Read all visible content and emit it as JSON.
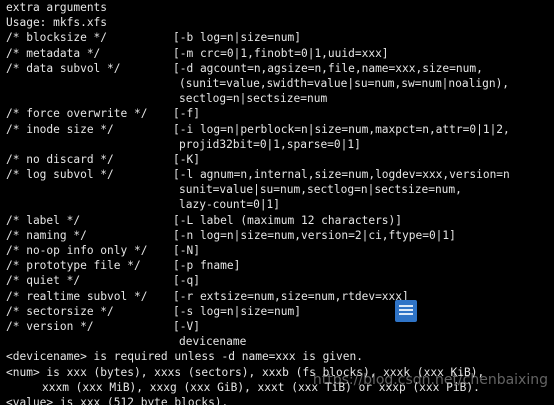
{
  "header": {
    "line1": "extra arguments",
    "line2": "Usage: mkfs.xfs"
  },
  "options": [
    {
      "label": "/* blocksize */",
      "args": [
        "[-b log=n|size=num]"
      ]
    },
    {
      "label": "/* metadata */",
      "args": [
        "[-m crc=0|1,finobt=0|1,uuid=xxx]"
      ]
    },
    {
      "label": "/* data subvol */",
      "args": [
        "[-d agcount=n,agsize=n,file,name=xxx,size=num,",
        "(sunit=value,swidth=value|su=num,sw=num|noalign),",
        "sectlog=n|sectsize=num"
      ]
    },
    {
      "label": "/* force overwrite */",
      "args": [
        "[-f]"
      ]
    },
    {
      "label": "/* inode size */",
      "args": [
        "[-i log=n|perblock=n|size=num,maxpct=n,attr=0|1|2,",
        "projid32bit=0|1,sparse=0|1]"
      ]
    },
    {
      "label": "/* no discard */",
      "args": [
        "[-K]"
      ]
    },
    {
      "label": "/* log subvol */",
      "args": [
        "[-l agnum=n,internal,size=num,logdev=xxx,version=n",
        "sunit=value|su=num,sectlog=n|sectsize=num,",
        "lazy-count=0|1]"
      ]
    },
    {
      "label": "/* label */",
      "args": [
        "[-L label (maximum 12 characters)]"
      ]
    },
    {
      "label": "/* naming */",
      "args": [
        "[-n log=n|size=num,version=2|ci,ftype=0|1]"
      ]
    },
    {
      "label": "/* no-op info only */",
      "args": [
        "[-N]"
      ]
    },
    {
      "label": "/* prototype file */",
      "args": [
        "[-p fname]"
      ]
    },
    {
      "label": "/* quiet */",
      "args": [
        "[-q]"
      ]
    },
    {
      "label": "/* realtime subvol */",
      "args": [
        "[-r extsize=num,size=num,rtdev=xxx]"
      ]
    },
    {
      "label": "/* sectorsize */",
      "args": [
        "[-s log=n|size=num]"
      ]
    },
    {
      "label": "/* version */",
      "args": [
        "[-V]"
      ]
    }
  ],
  "devicename_line": "devicename",
  "notes": {
    "devicename_required": "<devicename> is required unless -d name=xxx is given.",
    "num_line1": "<num> is xxx (bytes), xxxs (sectors), xxxb (fs blocks), xxxk (xxx KiB),",
    "num_line2": "xxxm (xxx MiB), xxxg (xxx GiB), xxxt (xxx TiB) or xxxp (xxx PiB).",
    "value_line": "<value> is xxx (512 byte blocks)."
  },
  "watermark": "https://blog.csdn.net/chenbaixing",
  "colors": {
    "background": "#000000",
    "text": "#e6e6e6",
    "taskbar_icon": "#2f74c7"
  },
  "icons": [
    "document-lines-icon"
  ]
}
